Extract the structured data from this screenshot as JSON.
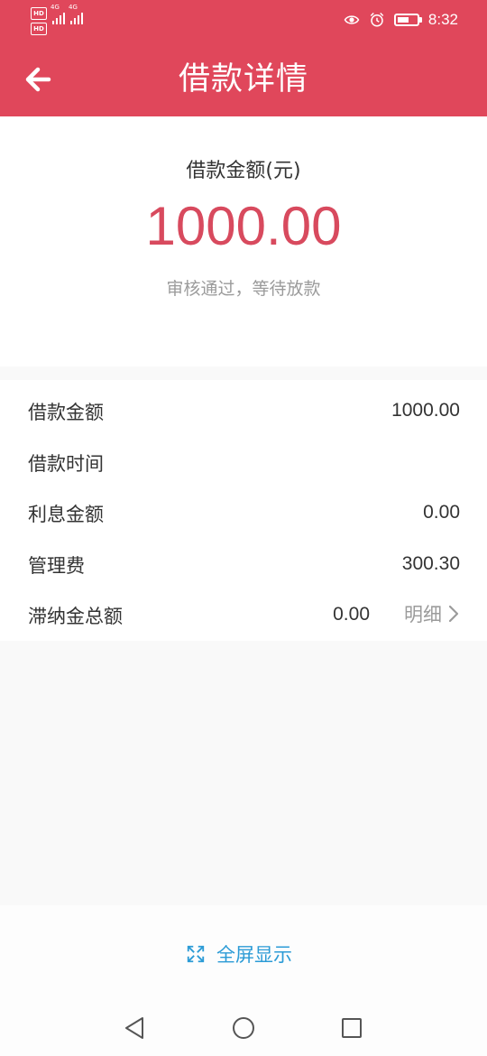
{
  "status_bar": {
    "hd_badge": "HD",
    "network_label": "4G",
    "time": "8:32",
    "icons": [
      "eye-icon",
      "alarm-icon",
      "battery-icon"
    ]
  },
  "header": {
    "title": "借款详情",
    "back_icon": "arrow-left-icon"
  },
  "summary": {
    "label": "借款金额(元)",
    "amount": "1000.00",
    "status": "审核通过，等待放款"
  },
  "details": {
    "rows": [
      {
        "label": "借款金额",
        "value": "1000.00"
      },
      {
        "label": "借款时间",
        "value": ""
      },
      {
        "label": "利息金额",
        "value": "0.00"
      },
      {
        "label": "管理费",
        "value": "300.30"
      },
      {
        "label": "滞纳金总额",
        "value": "0.00",
        "detail_link": "明细"
      }
    ]
  },
  "fullscreen": {
    "label": "全屏显示",
    "icon": "expand-icon"
  },
  "nav_bar": {
    "icons": [
      "back-triangle-icon",
      "home-circle-icon",
      "recent-square-icon"
    ]
  },
  "colors": {
    "brand_red": "#e0475b",
    "amount_red": "#d84a5e",
    "link_blue": "#2b9bd6",
    "muted_gray": "#9b9b9b"
  }
}
